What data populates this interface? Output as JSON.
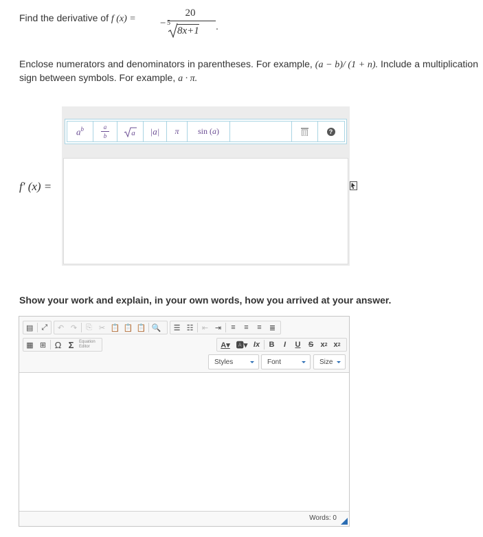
{
  "question": {
    "prefix": "Find the derivative of ",
    "function_lhs": "f (x) =",
    "minus": "−",
    "numerator": "20",
    "root_index": "5",
    "radicand": "8x+1",
    "period": "."
  },
  "instructions": {
    "text1": "Enclose numerators and denominators in parentheses. For example, ",
    "example1": "(a − b)/ (1 + n).",
    "text2": " Include a multiplication sign between symbols. For example, ",
    "example2": "a · π."
  },
  "math_toolbar": {
    "buttons": [
      {
        "name": "power",
        "label": "a^b"
      },
      {
        "name": "fraction",
        "label": "a/b"
      },
      {
        "name": "sqrt",
        "label": "√a"
      },
      {
        "name": "abs",
        "label": "|a|"
      },
      {
        "name": "pi",
        "label": "π"
      },
      {
        "name": "sin",
        "label": "sin (a)"
      }
    ],
    "help_label": "?"
  },
  "answer": {
    "label": "f′ (x) =",
    "value": ""
  },
  "work": {
    "prompt": "Show your work and explain, in your own words, how you arrived at your answer.",
    "equation_editor_label_1": "Equation",
    "equation_editor_label_2": "Editor",
    "styles_label": "Styles",
    "font_label": "Font",
    "size_label": "Size",
    "words_label": "Words: 0",
    "body_text": ""
  }
}
